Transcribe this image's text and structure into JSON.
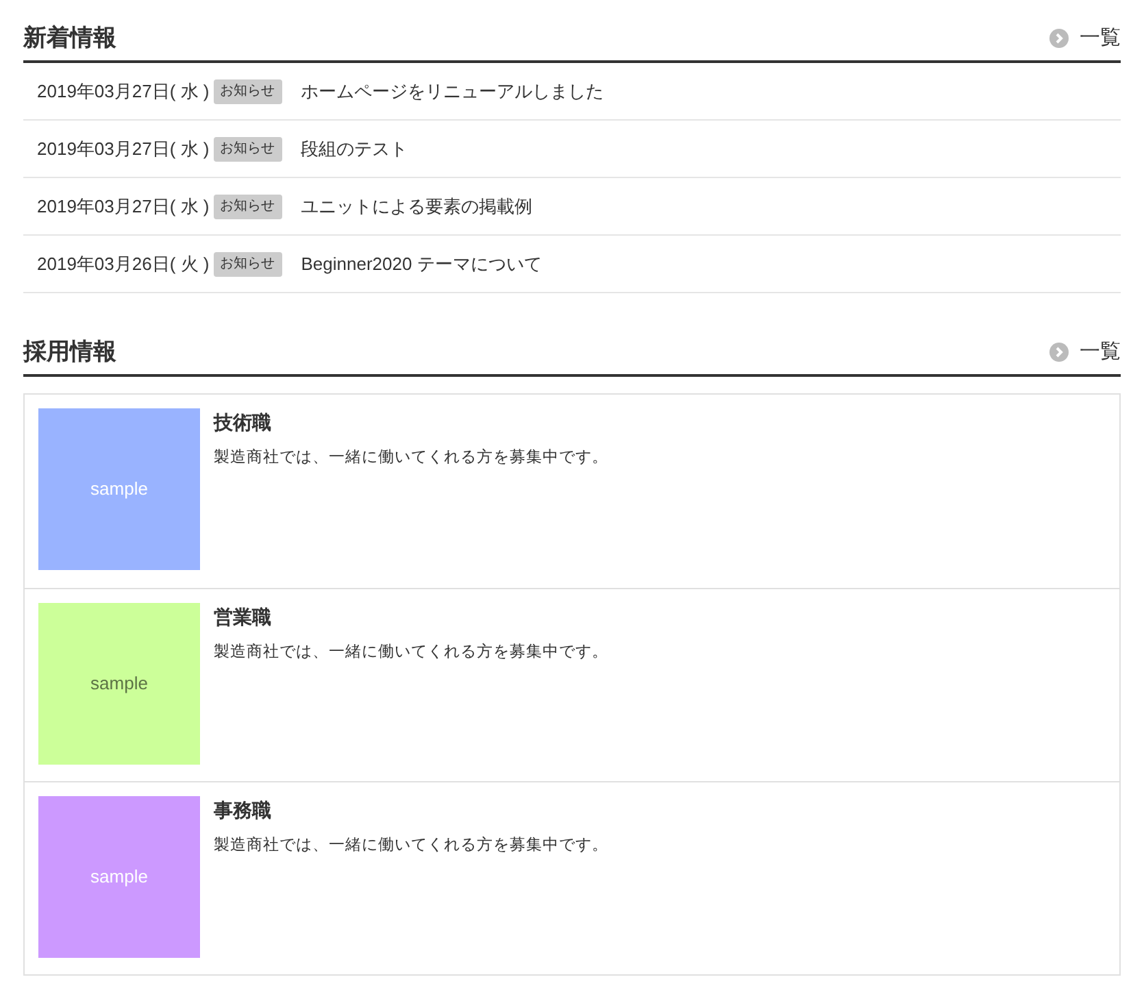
{
  "news": {
    "title": "新着情報",
    "more_link": "一覧",
    "items": [
      {
        "date": "2019年03月27日( 水 )",
        "tag": "お知らせ",
        "title": "ホームページをリニューアルしました"
      },
      {
        "date": "2019年03月27日( 水 )",
        "tag": "お知らせ",
        "title": "段組のテスト"
      },
      {
        "date": "2019年03月27日( 水 )",
        "tag": "お知らせ",
        "title": "ユニットによる要素の掲載例"
      },
      {
        "date": "2019年03月26日( 火 )",
        "tag": "お知らせ",
        "title": "Beginner2020 テーマについて"
      }
    ]
  },
  "recruit": {
    "title": "採用情報",
    "more_link": "一覧",
    "items": [
      {
        "image_label": "sample",
        "color": "#99b3ff",
        "title": "技術職",
        "description": "製造商社では、一緒に働いてくれる方を募集中です。"
      },
      {
        "image_label": "sample",
        "color": "#ccff99",
        "title": "営業職",
        "description": "製造商社では、一緒に働いてくれる方を募集中です。"
      },
      {
        "image_label": "sample",
        "color": "#cc99ff",
        "title": "事務職",
        "description": "製造商社では、一緒に働いてくれる方を募集中です。"
      }
    ]
  }
}
